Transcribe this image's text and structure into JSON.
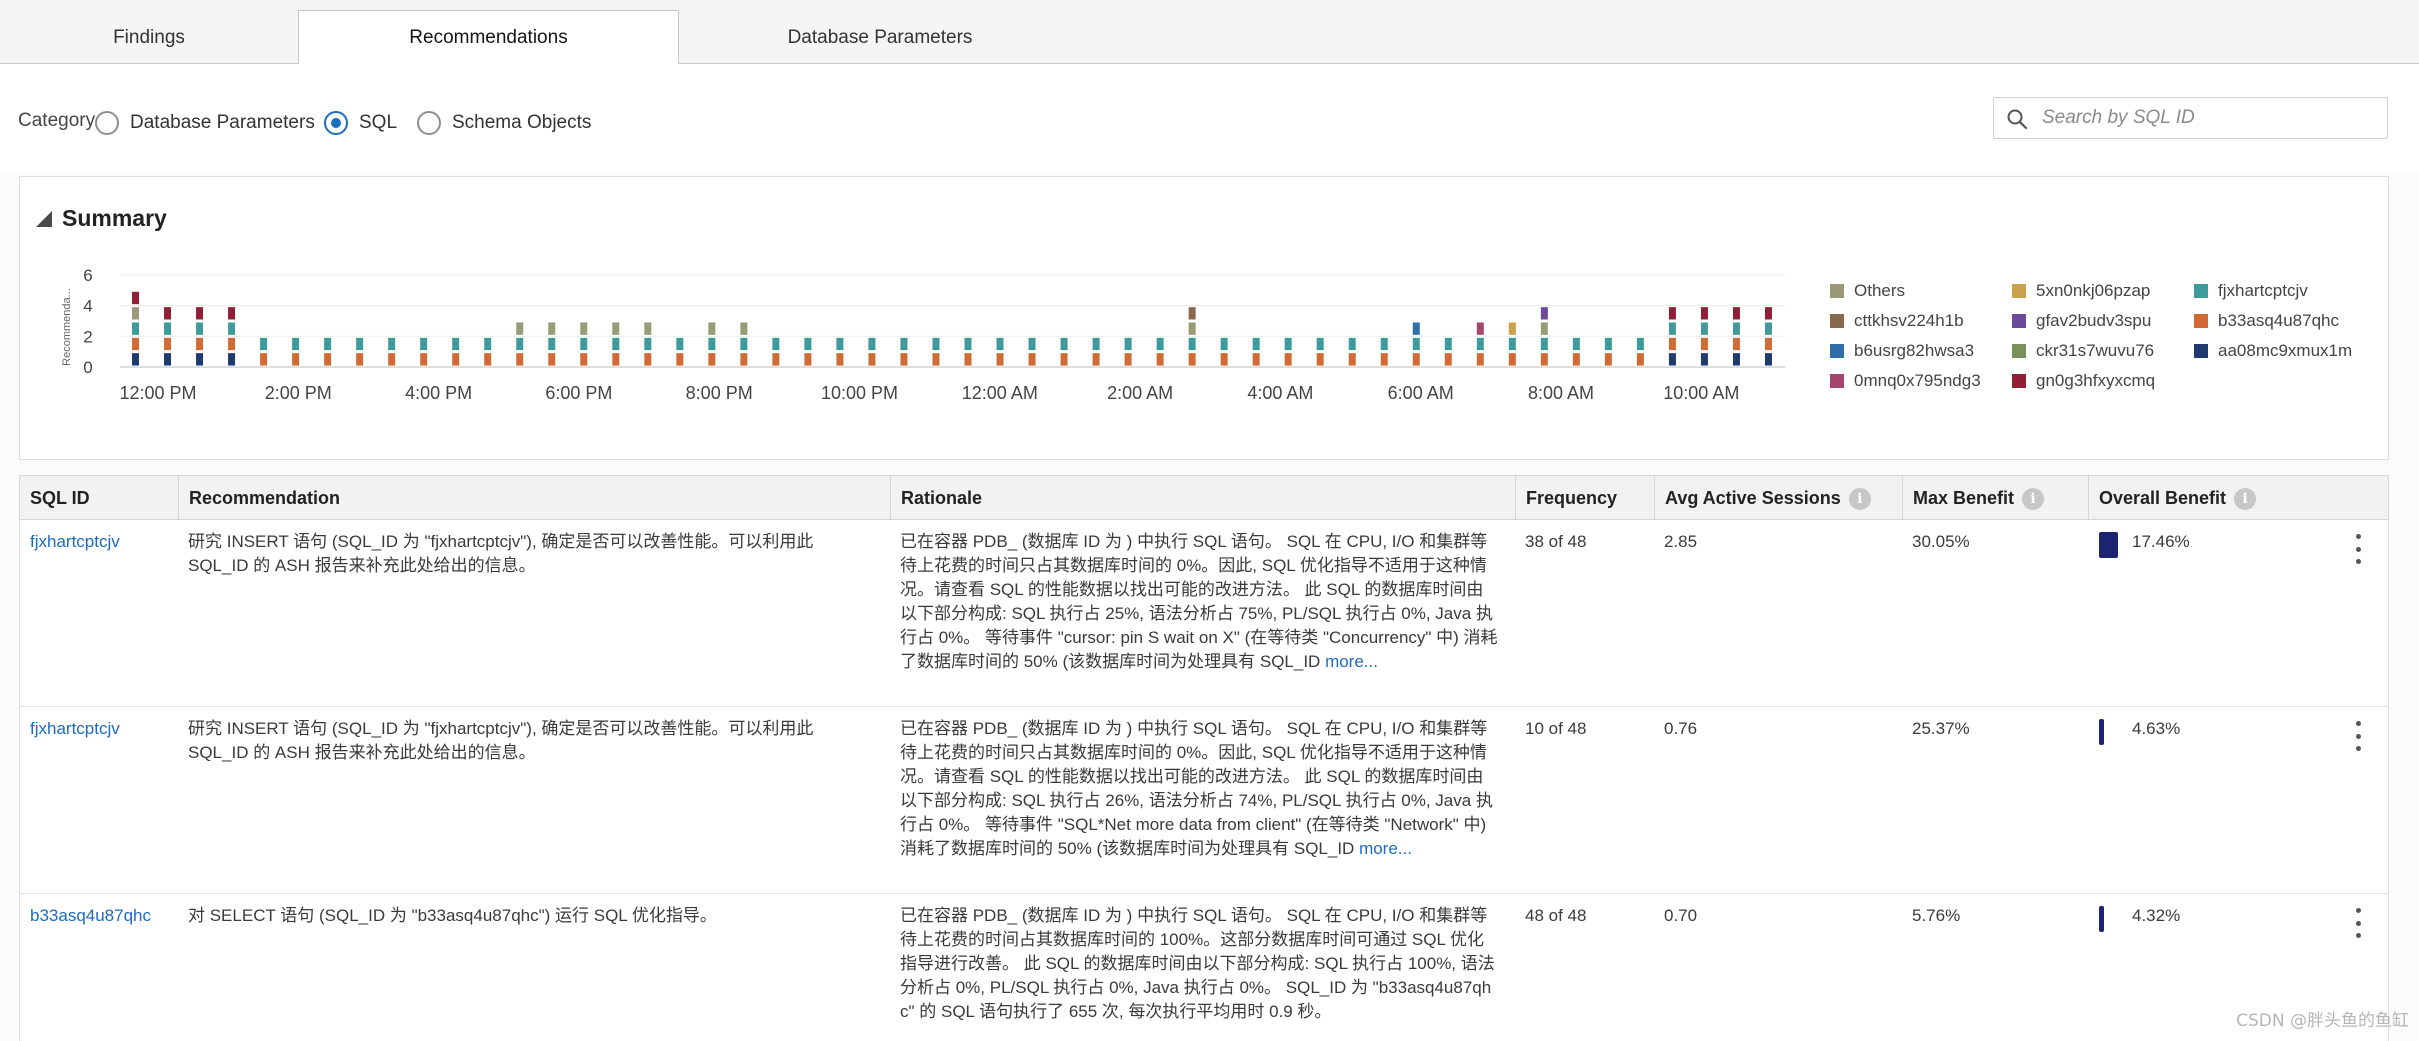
{
  "tabs": [
    {
      "label": "Findings"
    },
    {
      "label": "Recommendations"
    },
    {
      "label": "Database Parameters"
    }
  ],
  "filters": {
    "category_label": "Category",
    "options": [
      {
        "label": "Database Parameters",
        "checked": false
      },
      {
        "label": "SQL",
        "checked": true
      },
      {
        "label": "Schema Objects",
        "checked": false
      }
    ],
    "search_placeholder": "Search by SQL ID",
    "search_icon": "search-icon"
  },
  "summary": {
    "title": "Summary"
  },
  "chart_data": {
    "type": "bar",
    "stacked": true,
    "ylabel": "Recommenda...",
    "ylim": [
      0,
      6
    ],
    "yticks": [
      "0",
      "2",
      "4",
      "6"
    ],
    "xticks": [
      "12:00 PM",
      "2:00 PM",
      "4:00 PM",
      "6:00 PM",
      "8:00 PM",
      "10:00 PM",
      "12:00 AM",
      "2:00 AM",
      "4:00 AM",
      "6:00 AM",
      "8:00 AM",
      "10:00 AM"
    ],
    "grid": true,
    "legend_position": "right",
    "series": [
      {
        "name": "aa08mc9xmux1m",
        "color": "#1f3a6e",
        "values": [
          1,
          1,
          1,
          1,
          0,
          0,
          0,
          0,
          0,
          0,
          0,
          0,
          0,
          0,
          0,
          0,
          0,
          0,
          0,
          0,
          0,
          0,
          0,
          0,
          0,
          0,
          0,
          0,
          0,
          0,
          0,
          0,
          0,
          0,
          0,
          0,
          0,
          0,
          0,
          0,
          0,
          0,
          0,
          0,
          0,
          0,
          0,
          0,
          1,
          1,
          1,
          1
        ]
      },
      {
        "name": "b33asq4u87qhc",
        "color": "#d26a36",
        "values": [
          1,
          1,
          1,
          1,
          1,
          1,
          1,
          1,
          1,
          1,
          1,
          1,
          1,
          1,
          1,
          1,
          1,
          1,
          1,
          1,
          1,
          1,
          1,
          1,
          1,
          1,
          1,
          1,
          1,
          1,
          1,
          1,
          1,
          1,
          1,
          1,
          1,
          1,
          1,
          1,
          1,
          1,
          1,
          1,
          1,
          1,
          1,
          1,
          1,
          1,
          1,
          1
        ]
      },
      {
        "name": "fjxhartcptcjv",
        "color": "#3f9a9a",
        "values": [
          1,
          1,
          1,
          1,
          1,
          1,
          1,
          1,
          1,
          1,
          1,
          1,
          1,
          1,
          1,
          1,
          1,
          1,
          1,
          1,
          1,
          1,
          1,
          1,
          1,
          1,
          1,
          1,
          1,
          1,
          1,
          1,
          1,
          1,
          1,
          1,
          1,
          1,
          1,
          1,
          1,
          1,
          1,
          1,
          1,
          1,
          1,
          1,
          1,
          1,
          1,
          1
        ]
      },
      {
        "name": "5xn0nkj06pzap",
        "color": "#c9a24a",
        "values": [
          0,
          0,
          0,
          0,
          0,
          0,
          0,
          0,
          0,
          0,
          0,
          0,
          0,
          0,
          0,
          0,
          0,
          0,
          0,
          0,
          0,
          0,
          0,
          0,
          0,
          0,
          0,
          0,
          0,
          0,
          0,
          0,
          0,
          0,
          0,
          0,
          0,
          0,
          0,
          0,
          0,
          0,
          0,
          1,
          0,
          0,
          0,
          0,
          0,
          0,
          0,
          0
        ]
      },
      {
        "name": "Others",
        "color": "#9a9a78",
        "values": [
          1,
          0,
          0,
          0,
          0,
          0,
          0,
          0,
          0,
          0,
          0,
          0,
          1,
          1,
          1,
          1,
          1,
          0,
          1,
          1,
          0,
          0,
          0,
          0,
          0,
          0,
          0,
          0,
          0,
          0,
          0,
          0,
          0,
          1,
          0,
          0,
          0,
          0,
          0,
          0,
          0,
          0,
          0,
          0,
          1,
          0,
          0,
          0,
          0,
          0,
          0,
          0
        ]
      },
      {
        "name": "cttkhsv224h1b",
        "color": "#8a6a4f",
        "values": [
          0,
          0,
          0,
          0,
          0,
          0,
          0,
          0,
          0,
          0,
          0,
          0,
          0,
          0,
          0,
          0,
          0,
          0,
          0,
          0,
          0,
          0,
          0,
          0,
          0,
          0,
          0,
          0,
          0,
          0,
          0,
          0,
          0,
          1,
          0,
          0,
          0,
          0,
          0,
          0,
          0,
          0,
          0,
          0,
          0,
          0,
          0,
          0,
          0,
          0,
          0,
          0
        ]
      },
      {
        "name": "b6usrg82hwsa3",
        "color": "#2f6eab",
        "values": [
          0,
          0,
          0,
          0,
          0,
          0,
          0,
          0,
          0,
          0,
          0,
          0,
          0,
          0,
          0,
          0,
          0,
          0,
          0,
          0,
          0,
          0,
          0,
          0,
          0,
          0,
          0,
          0,
          0,
          0,
          0,
          0,
          0,
          0,
          0,
          0,
          0,
          0,
          0,
          0,
          1,
          0,
          0,
          0,
          0,
          0,
          0,
          0,
          0,
          0,
          0,
          0
        ]
      },
      {
        "name": "gfav2budv3spu",
        "color": "#6c4a9a",
        "values": [
          0,
          0,
          0,
          0,
          0,
          0,
          0,
          0,
          0,
          0,
          0,
          0,
          0,
          0,
          0,
          0,
          0,
          0,
          0,
          0,
          0,
          0,
          0,
          0,
          0,
          0,
          0,
          0,
          0,
          0,
          0,
          0,
          0,
          0,
          0,
          0,
          0,
          0,
          0,
          0,
          0,
          0,
          0,
          0,
          1,
          0,
          0,
          0,
          0,
          0,
          0,
          0
        ]
      },
      {
        "name": "ckr31s7wuvu76",
        "color": "#78925a",
        "values": [
          0,
          0,
          0,
          0,
          0,
          0,
          0,
          0,
          0,
          0,
          0,
          0,
          0,
          0,
          0,
          0,
          0,
          0,
          0,
          0,
          0,
          0,
          0,
          0,
          0,
          0,
          0,
          0,
          0,
          0,
          0,
          0,
          0,
          0,
          0,
          0,
          0,
          0,
          0,
          0,
          0,
          0,
          0,
          0,
          0,
          0,
          0,
          0,
          0,
          0,
          0,
          0
        ]
      },
      {
        "name": "0mnq0x795ndg3",
        "color": "#a8456e",
        "values": [
          0,
          0,
          0,
          0,
          0,
          0,
          0,
          0,
          0,
          0,
          0,
          0,
          0,
          0,
          0,
          0,
          0,
          0,
          0,
          0,
          0,
          0,
          0,
          0,
          0,
          0,
          0,
          0,
          0,
          0,
          0,
          0,
          0,
          0,
          0,
          0,
          0,
          0,
          0,
          0,
          0,
          0,
          1,
          0,
          0,
          0,
          0,
          0,
          0,
          0,
          0,
          0
        ]
      },
      {
        "name": "gn0g3hfxyxcmq",
        "color": "#8e1f34",
        "values": [
          1,
          1,
          1,
          1,
          0,
          0,
          0,
          0,
          0,
          0,
          0,
          0,
          0,
          0,
          0,
          0,
          0,
          0,
          0,
          0,
          0,
          0,
          0,
          0,
          0,
          0,
          0,
          0,
          0,
          0,
          0,
          0,
          0,
          0,
          0,
          0,
          0,
          0,
          0,
          0,
          0,
          0,
          0,
          0,
          0,
          0,
          0,
          0,
          1,
          1,
          1,
          1
        ]
      }
    ]
  },
  "legend": [
    {
      "label": "Others",
      "color": "#9a9a78"
    },
    {
      "label": "5xn0nkj06pzap",
      "color": "#c9a24a"
    },
    {
      "label": "fjxhartcptcjv",
      "color": "#3f9a9a"
    },
    {
      "label": "cttkhsv224h1b",
      "color": "#8a6a4f"
    },
    {
      "label": "gfav2budv3spu",
      "color": "#6c4a9a"
    },
    {
      "label": "b33asq4u87qhc",
      "color": "#d26a36"
    },
    {
      "label": "b6usrg82hwsa3",
      "color": "#2f6eab"
    },
    {
      "label": "ckr31s7wuvu76",
      "color": "#78925a"
    },
    {
      "label": "aa08mc9xmux1m",
      "color": "#1f3a6e"
    },
    {
      "label": "0mnq0x795ndg3",
      "color": "#a8456e"
    },
    {
      "label": "gn0g3hfxyxcmq",
      "color": "#8e1f34"
    }
  ],
  "table": {
    "headers": {
      "sql_id": "SQL ID",
      "recommendation": "Recommendation",
      "rationale": "Rationale",
      "frequency": "Frequency",
      "avg_active_sessions": "Avg Active Sessions",
      "max_benefit": "Max Benefit",
      "overall_benefit": "Overall Benefit"
    },
    "info_icon": "info-icon",
    "rows": [
      {
        "sql_id": "fjxhartcptcjv",
        "recommendation": "研究 INSERT 语句 (SQL_ID 为 \"fjxhartcptcjv\"), 确定是否可以改善性能。可以利用此 SQL_ID 的 ASH 报告来补充此处给出的信息。",
        "rationale": "已在容器 PDB_       (数据库 ID 为              ) 中执行 SQL 语句。 SQL 在 CPU, I/O 和集群等待上花费的时间只占其数据库时间的 0%。因此, SQL 优化指导不适用于这种情况。请查看 SQL 的性能数据以找出可能的改进方法。 此 SQL 的数据库时间由以下部分构成: SQL 执行占 25%, 语法分析占 75%, PL/SQL 执行占 0%, Java 执行占 0%。 等待事件 \"cursor: pin S wait on X\" (在等待类 \"Concurrency\" 中) 消耗了数据库时间的 50% (该数据库时间为处理具有 SQL_ID",
        "more": "more...",
        "frequency": "38 of 48",
        "avg_active_sessions": "2.85",
        "max_benefit": "30.05%",
        "overall_benefit": "17.46%",
        "overall_benefit_value": 17.46
      },
      {
        "sql_id": "fjxhartcptcjv",
        "recommendation": "研究 INSERT 语句 (SQL_ID 为 \"fjxhartcptcjv\"), 确定是否可以改善性能。可以利用此 SQL_ID 的 ASH 报告来补充此处给出的信息。",
        "rationale": "已在容器 PDB_       (数据库 ID 为              ) 中执行 SQL 语句。 SQL 在 CPU, I/O 和集群等待上花费的时间只占其数据库时间的 0%。因此, SQL 优化指导不适用于这种情况。请查看 SQL 的性能数据以找出可能的改进方法。 此 SQL 的数据库时间由以下部分构成: SQL 执行占 26%, 语法分析占 74%, PL/SQL 执行占 0%, Java 执行占 0%。 等待事件 \"SQL*Net more data from client\" (在等待类 \"Network\" 中) 消耗了数据库时间的 50% (该数据库时间为处理具有 SQL_ID",
        "more": "more...",
        "frequency": "10 of 48",
        "avg_active_sessions": "0.76",
        "max_benefit": "25.37%",
        "overall_benefit": "4.63%",
        "overall_benefit_value": 4.63
      },
      {
        "sql_id": "b33asq4u87qhc",
        "recommendation": "对 SELECT 语句 (SQL_ID 为 \"b33asq4u87qhc\") 运行 SQL 优化指导。",
        "rationale": "已在容器 PDB_       (数据库 ID 为              ) 中执行 SQL 语句。 SQL 在 CPU, I/O 和集群等待上花费的时间占其数据库时间的 100%。这部分数据库时间可通过 SQL 优化指导进行改善。 此 SQL 的数据库时间由以下部分构成: SQL 执行占 100%, 语法分析占 0%, PL/SQL 执行占 0%, Java 执行占 0%。 SQL_ID 为 \"b33asq4u87qhc\" 的 SQL 语句执行了 655 次, 每次执行平均用时 0.9 秒。",
        "more": "",
        "frequency": "48 of 48",
        "avg_active_sessions": "0.70",
        "max_benefit": "5.76%",
        "overall_benefit": "4.32%",
        "overall_benefit_value": 4.32
      }
    ]
  },
  "watermark": "CSDN @胖头鱼的鱼缸"
}
